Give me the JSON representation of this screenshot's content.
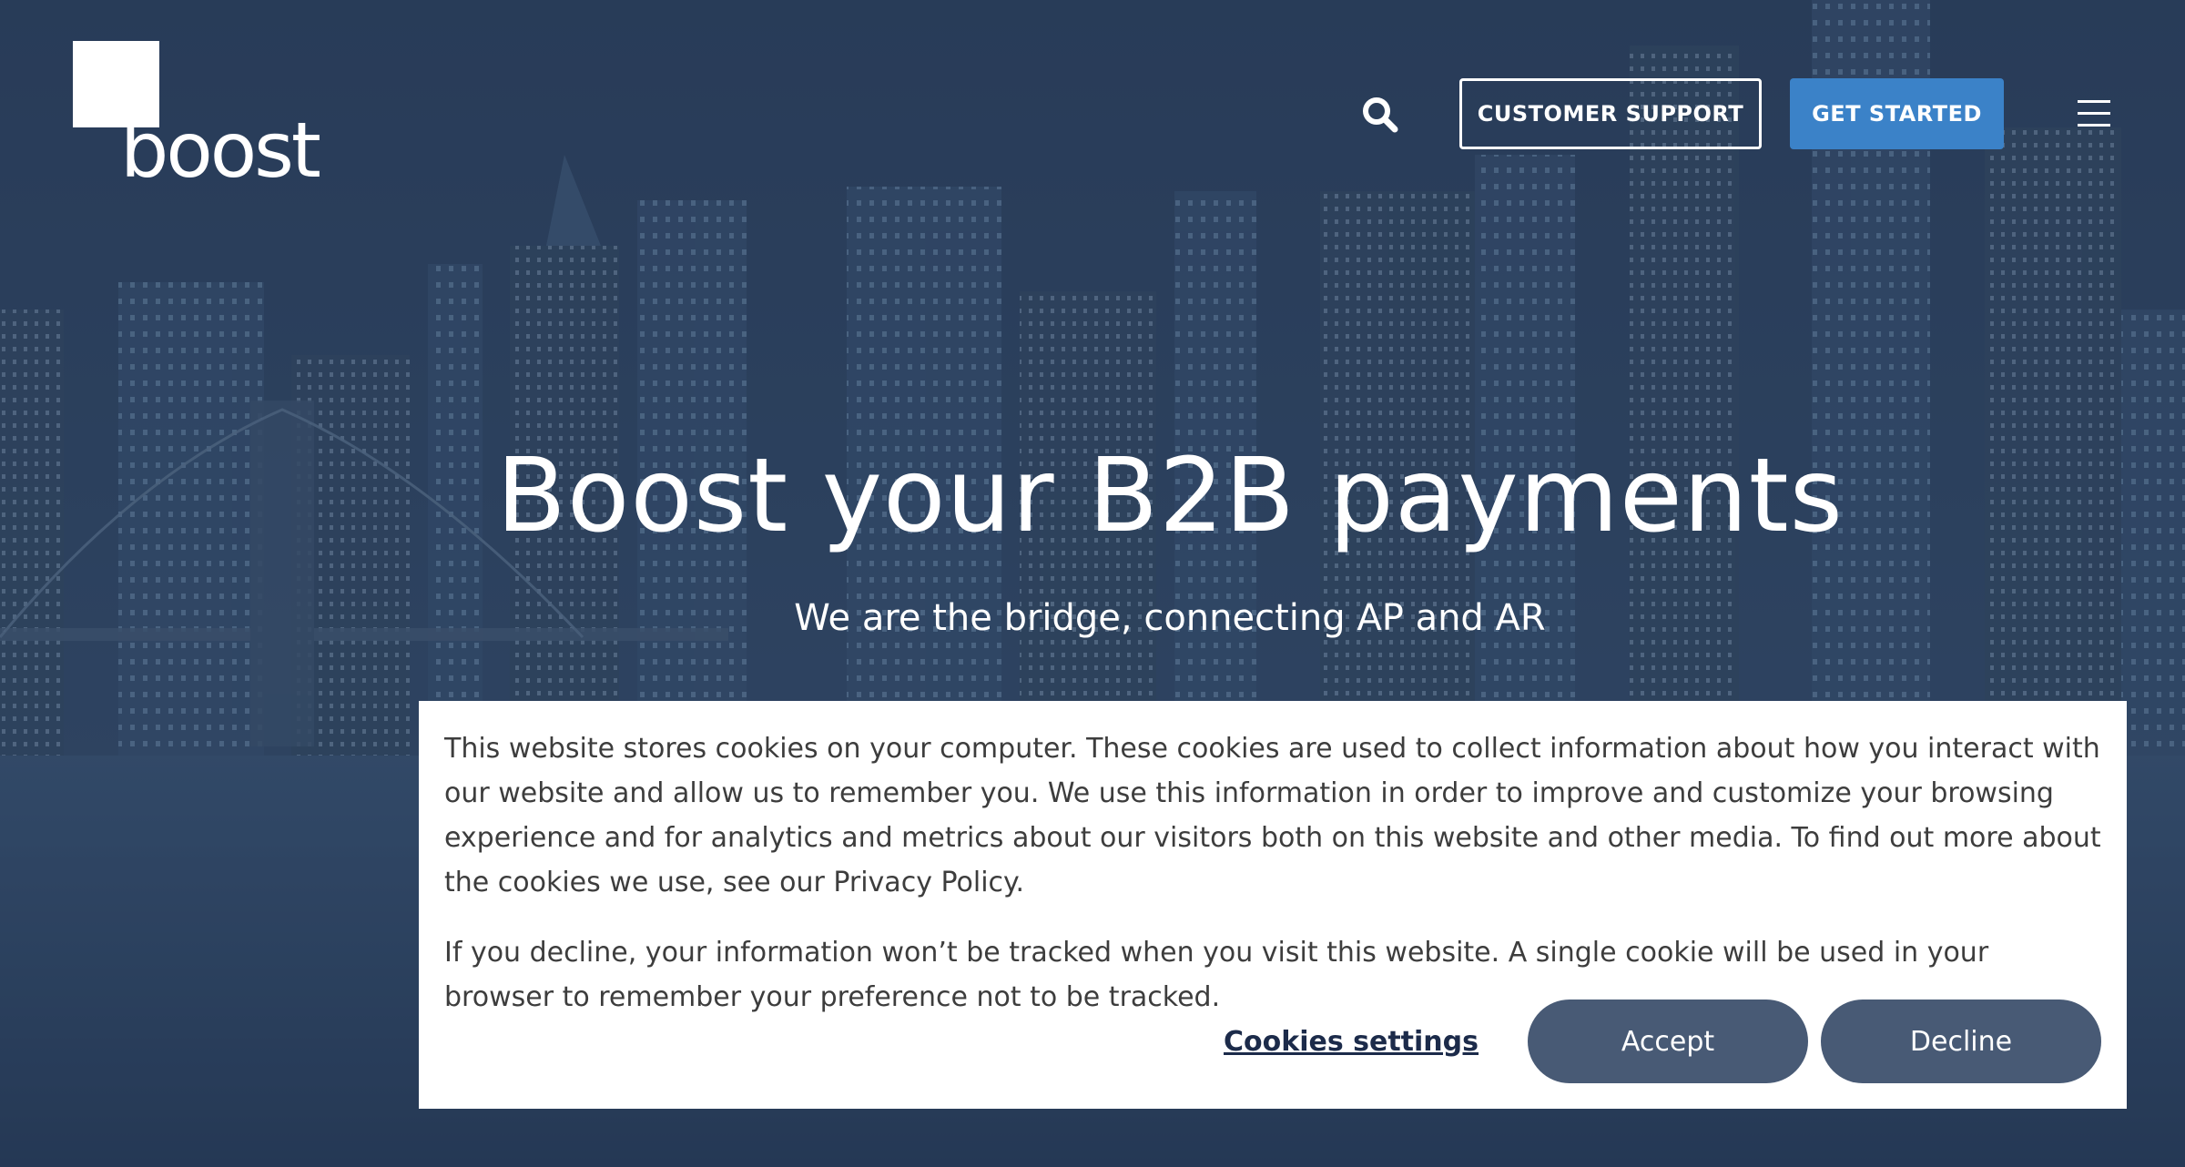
{
  "header": {
    "logo_text": "boost",
    "search_icon": "search-icon",
    "support_label": "CUSTOMER SUPPORT",
    "get_started_label": "GET STARTED",
    "menu_icon": "hamburger-menu-icon"
  },
  "hero": {
    "title": "Boost your B2B payments",
    "subtitle": "We are the bridge, connecting AP and AR"
  },
  "cookie_banner": {
    "paragraph_1": "This website stores cookies on your computer. These cookies are used to collect information about how you interact with our website and allow us to remember you. We use this information in order to improve and customize your browsing experience and for analytics and metrics about our visitors both on this website and other media. To find out more about the cookies we use, see our Privacy Policy.",
    "paragraph_2": "If you decline, your information won’t be tracked when you visit this website. A single cookie will be used in your browser to remember your preference not to be tracked.",
    "settings_label": "Cookies settings",
    "accept_label": "Accept",
    "decline_label": "Decline"
  },
  "colors": {
    "primary_button": "#3b82c8",
    "cookie_button": "#485a75",
    "hero_overlay": "#2c4360",
    "link_dark": "#1c2b4a"
  }
}
